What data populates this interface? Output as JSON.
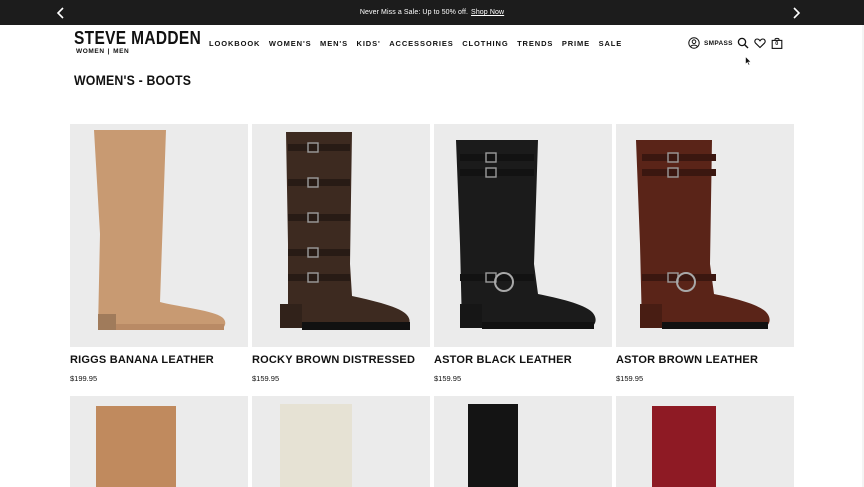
{
  "promo": {
    "message": "Never Miss a Sale: Up to 50% off.",
    "link": "Shop Now"
  },
  "logo": {
    "title": "STEVE MADDEN",
    "sub_women": "WOMEN",
    "sub_sep": "|",
    "sub_men": "MEN"
  },
  "nav": [
    "LOOKBOOK",
    "WOMEN'S",
    "MEN'S",
    "KIDS'",
    "ACCESSORIES",
    "CLOTHING",
    "TRENDS",
    "PRIME",
    "SALE"
  ],
  "utility": {
    "account_label": "SMPASS",
    "bag_count": "0"
  },
  "page": {
    "title": "WOMEN'S - BOOTS"
  },
  "products": [
    {
      "name": "RIGGS BANANA LEATHER",
      "price": "$199.95",
      "color": "#c89a72"
    },
    {
      "name": "ROCKY BROWN DISTRESSED",
      "price": "$159.95",
      "color": "#3d2a20"
    },
    {
      "name": "ASTOR BLACK LEATHER",
      "price": "$159.95",
      "color": "#1b1b1b"
    },
    {
      "name": "ASTOR BROWN LEATHER",
      "price": "$159.95",
      "color": "#5a2418"
    }
  ],
  "products_row2_colors": [
    "#c08a5e",
    "#e6e2d4",
    "#141414",
    "#8e1a24"
  ]
}
